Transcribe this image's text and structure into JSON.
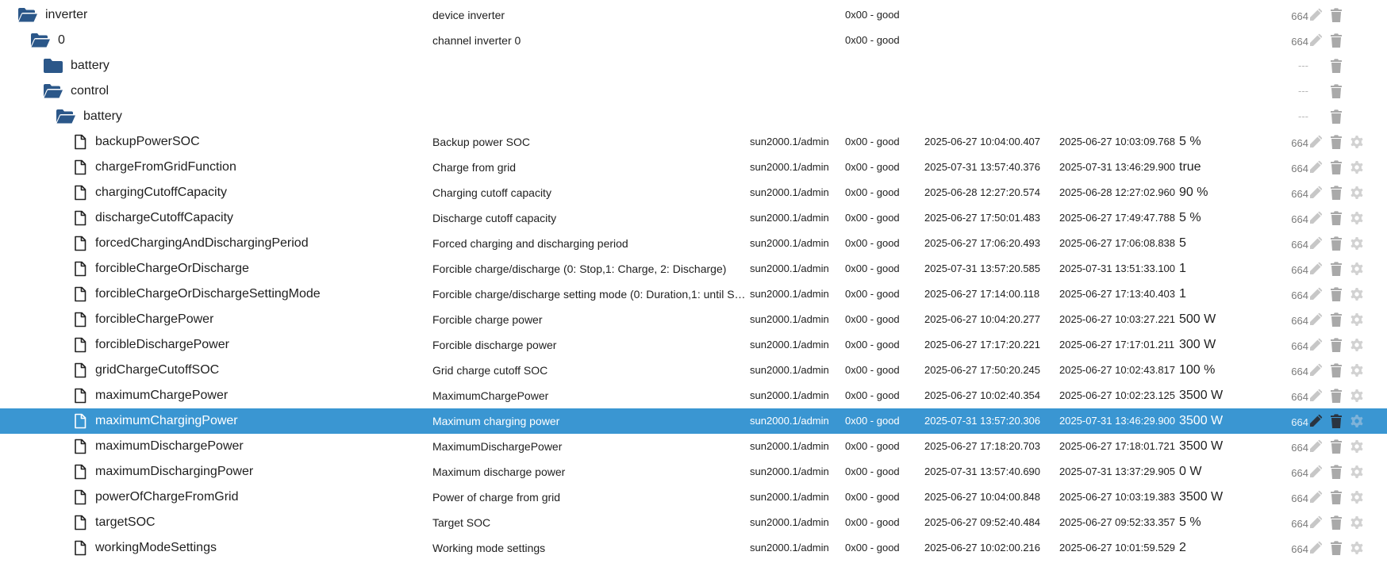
{
  "tree": {
    "folders": [
      {
        "id": "inverter",
        "name": "inverter",
        "description": "device inverter",
        "quality": "0x00 - good",
        "acl": "664",
        "open": true
      },
      {
        "id": "zero",
        "name": "0",
        "description": "channel inverter 0",
        "quality": "0x00 - good",
        "acl": "664",
        "open": true
      },
      {
        "id": "battery",
        "name": "battery",
        "open": false,
        "acl_placeholder": "---"
      },
      {
        "id": "control",
        "name": "control",
        "open": true,
        "acl_placeholder": "---"
      },
      {
        "id": "control_battery",
        "name": "battery",
        "open": true,
        "acl_placeholder": "---"
      }
    ],
    "states": [
      {
        "name": "backupPowerSOC",
        "description": "Backup power SOC",
        "role": "sun2000.1/admin",
        "quality": "0x00 - good",
        "ts": "2025-06-27 10:04:00.407",
        "lc": "2025-06-27 10:03:09.768",
        "value": "5 %",
        "acl": "664"
      },
      {
        "name": "chargeFromGridFunction",
        "description": "Charge from grid",
        "role": "sun2000.1/admin",
        "quality": "0x00 - good",
        "ts": "2025-07-31 13:57:40.376",
        "lc": "2025-07-31 13:46:29.900",
        "value": "true",
        "acl": "664"
      },
      {
        "name": "chargingCutoffCapacity",
        "description": "Charging cutoff capacity",
        "role": "sun2000.1/admin",
        "quality": "0x00 - good",
        "ts": "2025-06-28 12:27:20.574",
        "lc": "2025-06-28 12:27:02.960",
        "value": "90 %",
        "acl": "664"
      },
      {
        "name": "dischargeCutoffCapacity",
        "description": "Discharge cutoff capacity",
        "role": "sun2000.1/admin",
        "quality": "0x00 - good",
        "ts": "2025-06-27 17:50:01.483",
        "lc": "2025-06-27 17:49:47.788",
        "value": "5 %",
        "acl": "664"
      },
      {
        "name": "forcedChargingAndDischargingPeriod",
        "description": "Forced charging and discharging period",
        "role": "sun2000.1/admin",
        "quality": "0x00 - good",
        "ts": "2025-06-27 17:06:20.493",
        "lc": "2025-06-27 17:06:08.838",
        "value": "5",
        "acl": "664"
      },
      {
        "name": "forcibleChargeOrDischarge",
        "description": "Forcible charge/discharge (0: Stop,1: Charge, 2: Discharge)",
        "role": "sun2000.1/admin",
        "quality": "0x00 - good",
        "ts": "2025-07-31 13:57:20.585",
        "lc": "2025-07-31 13:51:33.100",
        "value": "1",
        "acl": "664"
      },
      {
        "name": "forcibleChargeOrDischargeSettingMode",
        "description": "Forcible charge/discharge setting mode (0: Duration,1: until SO…",
        "role": "sun2000.1/admin",
        "quality": "0x00 - good",
        "ts": "2025-06-27 17:14:00.118",
        "lc": "2025-06-27 17:13:40.403",
        "value": "1",
        "acl": "664"
      },
      {
        "name": "forcibleChargePower",
        "description": "Forcible charge power",
        "role": "sun2000.1/admin",
        "quality": "0x00 - good",
        "ts": "2025-06-27 10:04:20.277",
        "lc": "2025-06-27 10:03:27.221",
        "value": "500 W",
        "acl": "664"
      },
      {
        "name": "forcibleDischargePower",
        "description": "Forcible discharge power",
        "role": "sun2000.1/admin",
        "quality": "0x00 - good",
        "ts": "2025-06-27 17:17:20.221",
        "lc": "2025-06-27 17:17:01.211",
        "value": "300 W",
        "acl": "664"
      },
      {
        "name": "gridChargeCutoffSOC",
        "description": "Grid charge cutoff SOC",
        "role": "sun2000.1/admin",
        "quality": "0x00 - good",
        "ts": "2025-06-27 17:50:20.245",
        "lc": "2025-06-27 10:02:43.817",
        "value": "100 %",
        "acl": "664"
      },
      {
        "name": "maximumChargePower",
        "description": "MaximumChargePower",
        "role": "sun2000.1/admin",
        "quality": "0x00 - good",
        "ts": "2025-06-27 10:02:40.354",
        "lc": "2025-06-27 10:02:23.125",
        "value": "3500 W",
        "acl": "664"
      },
      {
        "name": "maximumChargingPower",
        "description": "Maximum charging power",
        "role": "sun2000.1/admin",
        "quality": "0x00 - good",
        "ts": "2025-07-31 13:57:20.306",
        "lc": "2025-07-31 13:46:29.900",
        "value": "3500 W",
        "acl": "664",
        "selected": true
      },
      {
        "name": "maximumDischargePower",
        "description": "MaximumDischargePower",
        "role": "sun2000.1/admin",
        "quality": "0x00 - good",
        "ts": "2025-06-27 17:18:20.703",
        "lc": "2025-06-27 17:18:01.721",
        "value": "3500 W",
        "acl": "664"
      },
      {
        "name": "maximumDischargingPower",
        "description": "Maximum discharge power",
        "role": "sun2000.1/admin",
        "quality": "0x00 - good",
        "ts": "2025-07-31 13:57:40.690",
        "lc": "2025-07-31 13:37:29.905",
        "value": "0 W",
        "acl": "664"
      },
      {
        "name": "powerOfChargeFromGrid",
        "description": "Power of charge from grid",
        "role": "sun2000.1/admin",
        "quality": "0x00 - good",
        "ts": "2025-06-27 10:04:00.848",
        "lc": "2025-06-27 10:03:19.383",
        "value": "3500 W",
        "acl": "664"
      },
      {
        "name": "targetSOC",
        "description": "Target SOC",
        "role": "sun2000.1/admin",
        "quality": "0x00 - good",
        "ts": "2025-06-27 09:52:40.484",
        "lc": "2025-06-27 09:52:33.357",
        "value": "5 %",
        "acl": "664"
      },
      {
        "name": "workingModeSettings",
        "description": "Working mode settings",
        "role": "sun2000.1/admin",
        "quality": "0x00 - good",
        "ts": "2025-06-27 10:02:00.216",
        "lc": "2025-06-27 10:01:59.529",
        "value": "2",
        "acl": "664"
      }
    ]
  },
  "icons": {
    "folder_open": "folder-open-icon",
    "folder_closed": "folder-icon",
    "file": "file-icon",
    "edit": "pencil-icon",
    "delete": "trash-icon",
    "settings": "gear-icon"
  },
  "colors": {
    "selection": "#3a96d2",
    "folder": "#2b5789"
  }
}
